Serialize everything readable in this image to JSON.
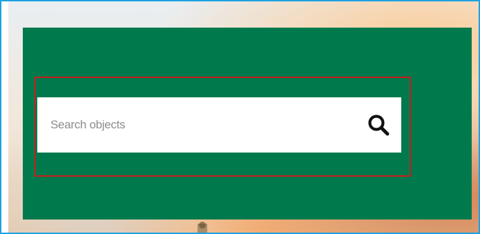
{
  "search": {
    "placeholder": "Search objects",
    "value": ""
  },
  "icons": {
    "search_button": "search-icon"
  },
  "colors": {
    "panel": "#007a4d",
    "highlight": "#cc1a1a",
    "frame": "#1ba1e2"
  }
}
